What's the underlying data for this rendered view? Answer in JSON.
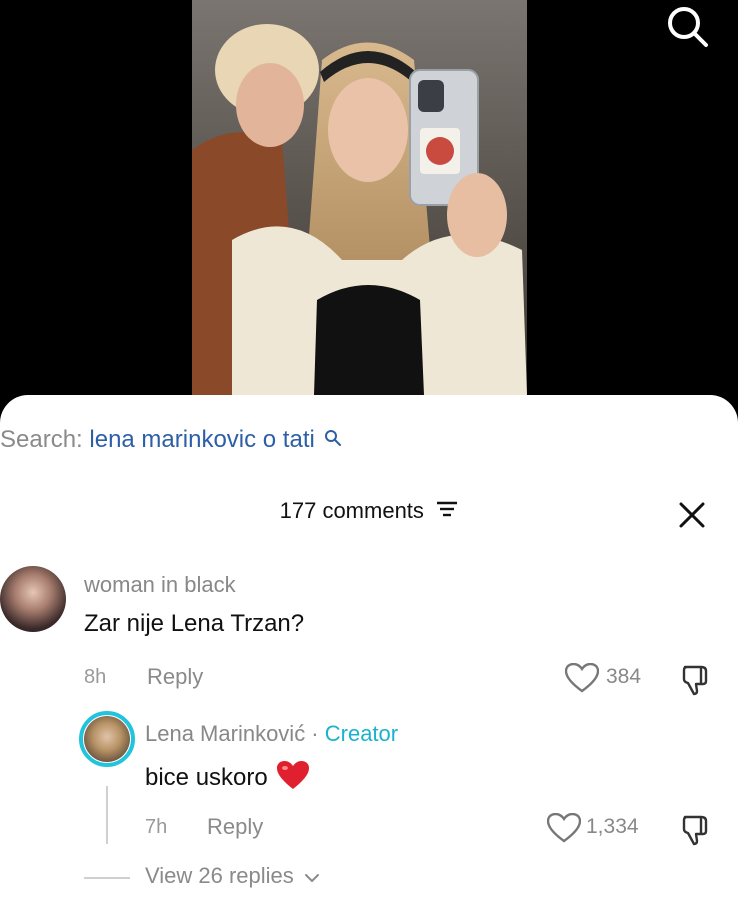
{
  "search": {
    "prefix": "Search:",
    "query": "lena marinkovic o tati"
  },
  "comments_header": {
    "count_label": "177 comments"
  },
  "comments": [
    {
      "username": "woman in black",
      "text": "Zar nije Lena Trzan?",
      "time": "8h",
      "reply_label": "Reply",
      "likes": "384"
    }
  ],
  "reply": {
    "username": "Lena Marinković",
    "separator": " · ",
    "badge": "Creator",
    "text": "bice uskoro",
    "time": "7h",
    "reply_label": "Reply",
    "likes": "1,334"
  },
  "view_replies_label": "View 26 replies",
  "colors": {
    "accent_link": "#2d5fa7",
    "creator": "#1ab3cb",
    "heart": "#e0202e"
  },
  "icons": [
    "search-icon",
    "filter-icon",
    "close-icon",
    "heart-outline-icon",
    "dislike-icon",
    "heart-emoji",
    "chevron-down-icon"
  ]
}
